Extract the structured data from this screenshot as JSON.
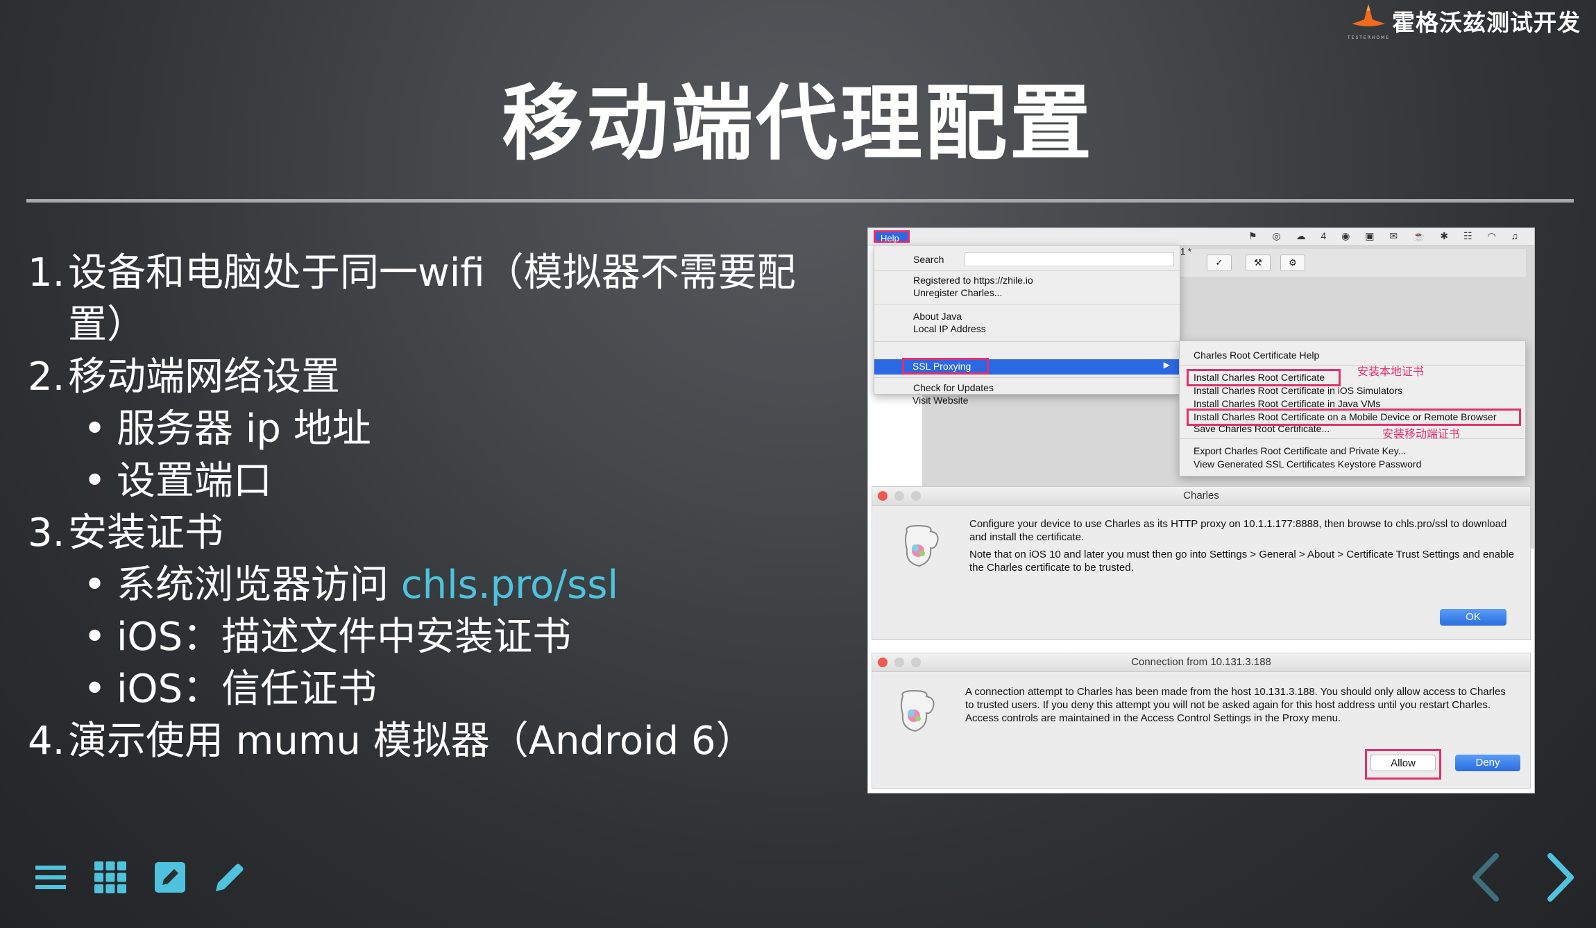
{
  "brand": {
    "name": "霍格沃兹测试开发",
    "logo_caption": "TESTERHOME"
  },
  "slide": {
    "title": "移动端代理配置",
    "items": [
      {
        "number": "1.",
        "text": "设备和电脑处于同一wifi（模拟器不需要配置）"
      },
      {
        "number": "2.",
        "text": "移动端网络设置",
        "bullets": [
          "服务器 ip 地址",
          "设置端口"
        ]
      },
      {
        "number": "3.",
        "text": "安装证书",
        "bullets": [
          {
            "text": "系统浏览器访问 ",
            "link": "chls.pro/ssl"
          },
          {
            "text": "iOS：描述文件中安装证书"
          },
          {
            "text": "iOS：信任证书"
          }
        ]
      },
      {
        "number": "4.",
        "text": "演示使用 mumu 模拟器（Android 6）"
      }
    ]
  },
  "screenshot": {
    "menubar": {
      "help_label": "Help",
      "status_text": "⚑ ◎ ☁ 4 ◉ ▣ ✉ ☕ ✱ ☷ ◠ ♫"
    },
    "toolbar": {
      "title_fragment": "1 *",
      "check": "✓",
      "tools": "⚒",
      "gear": "⚙"
    },
    "help_menu": {
      "search_label": "Search",
      "registered": "Registered to https://zhile.io",
      "unregister": "Unregister Charles...",
      "about_java": "About Java",
      "local_ip": "Local IP Address",
      "ssl_proxying": "SSL Proxying",
      "arrow": "▶",
      "check_updates": "Check for Updates",
      "visit_website": "Visit Website"
    },
    "ssl_submenu": {
      "items": [
        "Charles Root Certificate Help",
        "Install Charles Root Certificate",
        "Install Charles Root Certificate in iOS Simulators",
        "Install Charles Root Certificate in Java VMs",
        "Install Charles Root Certificate on a Mobile Device or Remote Browser",
        "Save Charles Root Certificate...",
        "Export Charles Root Certificate and Private Key...",
        "View Generated SSL Certificates Keystore Password"
      ],
      "note_local": "安装本地证书",
      "note_mobile": "安装移动端证书"
    },
    "charles_dialog": {
      "title": "Charles",
      "text1": "Configure your device to use Charles as its HTTP proxy on 10.1.1.177:8888, then browse to chls.pro/ssl to download and install the certificate.",
      "text2": "Note that on iOS 10 and later you must then go into Settings > General > About > Certificate Trust Settings and enable the Charles certificate to be trusted.",
      "ok": "OK"
    },
    "connection_dialog": {
      "title": "Connection from 10.131.3.188",
      "text": "A connection attempt to Charles has been made from the host 10.131.3.188. You should only allow access to Charles to trusted users. If you deny this attempt you will not be asked again for this host address until you restart Charles. Access controls are maintained in the Access Control Settings in the Proxy menu.",
      "allow": "Allow",
      "deny": "Deny"
    }
  },
  "colors": {
    "accent": "#4fc3dd",
    "highlight": "#e2306c",
    "menu_blue": "#2b68e3"
  },
  "icons": [
    "menu-icon",
    "grid-icon",
    "edit-note-icon",
    "pencil-icon",
    "prev-arrow-icon",
    "next-arrow-icon"
  ]
}
